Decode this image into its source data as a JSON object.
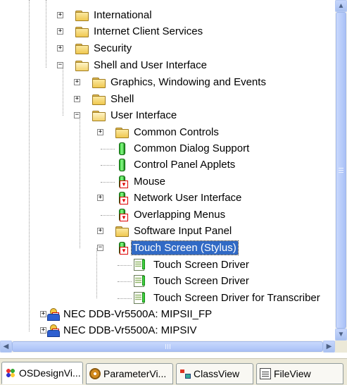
{
  "tree": {
    "items": [
      {
        "label": "International"
      },
      {
        "label": "Internet Client Services"
      },
      {
        "label": "Security"
      },
      {
        "label": "Shell and User Interface"
      },
      {
        "label": "Graphics, Windowing and Events"
      },
      {
        "label": "Shell"
      },
      {
        "label": "User Interface"
      },
      {
        "label": "Common Controls"
      },
      {
        "label": "Common Dialog Support"
      },
      {
        "label": "Control Panel Applets"
      },
      {
        "label": "Mouse"
      },
      {
        "label": "Network User Interface"
      },
      {
        "label": "Overlapping Menus"
      },
      {
        "label": "Software Input Panel"
      },
      {
        "label": "Touch Screen (Stylus)",
        "selected": true
      },
      {
        "label": "Touch Screen Driver"
      },
      {
        "label": "Touch Screen Driver"
      },
      {
        "label": "Touch Screen Driver for Transcriber"
      },
      {
        "label": "NEC DDB-Vr5500A: MIPSII_FP"
      },
      {
        "label": "NEC DDB-Vr5500A: MIPSIV"
      }
    ]
  },
  "scrollbars": {
    "up": "▲",
    "down": "▼",
    "left": "◀",
    "right": "▶"
  },
  "tabs": [
    {
      "label": "OSDesignVi...",
      "icon": "os-design-icon"
    },
    {
      "label": "ParameterVi...",
      "icon": "parameter-icon"
    },
    {
      "label": "ClassView",
      "icon": "class-icon"
    },
    {
      "label": "FileView",
      "icon": "file-icon"
    }
  ],
  "colors": {
    "selection": "#316ac5",
    "scrollbar_thumb": "#b6cbfa",
    "window_bg": "#ece9d8"
  }
}
